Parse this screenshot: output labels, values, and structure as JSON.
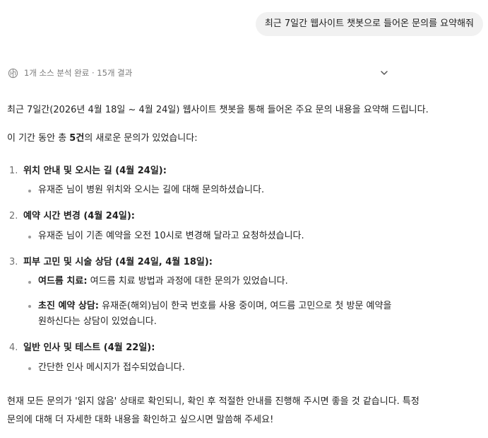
{
  "user_message": "최근 7일간 웹사이트 챗봇으로 들어온 문의를 요약해줘",
  "source_summary": "1개 소스 분석 완료 · 15개 결과",
  "icons": {
    "source": "brain-icon",
    "expand": "chevron-down-icon"
  },
  "answer": {
    "intro": "최근 7일간(2026년 4월 18일 ~ 4월 24일) 웹사이트 챗봇을 통해 들어온 주요 문의 내용을 요약해 드립니다.",
    "count_prefix": "이 기간 동안 총 ",
    "count_bold": "5건",
    "count_suffix": "의 새로운 문의가 있었습니다:",
    "items": [
      {
        "num": "1.",
        "title": "위치 안내 및 오시는 길 (4월 24일):",
        "bullets": [
          {
            "bold": "",
            "text": "유재준 님이 병원 위치와 오시는 길에 대해 문의하셨습니다."
          }
        ]
      },
      {
        "num": "2.",
        "title": "예약 시간 변경 (4월 24일):",
        "bullets": [
          {
            "bold": "",
            "text": "유재준 님이 기존 예약을 오전 10시로 변경해 달라고 요청하셨습니다."
          }
        ]
      },
      {
        "num": "3.",
        "title": "피부 고민 및 시술 상담 (4월 24일, 4월 18일):",
        "bullets": [
          {
            "bold": "여드름 치료:",
            "text": " 여드름 치료 방법과 과정에 대한 문의가 있었습니다."
          },
          {
            "bold": "초진 예약 상담:",
            "text": " 유재준(해외)님이 한국 번호를 사용 중이며, 여드름 고민으로 첫 방문 예약을",
            "text2": "원하신다는 상담이 있었습니다."
          }
        ]
      },
      {
        "num": "4.",
        "title": "일반 인사 및 테스트 (4월 22일):",
        "bullets": [
          {
            "bold": "",
            "text": "간단한 인사 메시지가 접수되었습니다."
          }
        ]
      }
    ],
    "closing_line1": "현재 모든 문의가 '읽지 않음' 상태로 확인되니, 확인 후 적절한 안내를 진행해 주시면 좋을 것 같습니다. 특정",
    "closing_line2": "문의에 대해 더 자세한 대화 내용을 확인하고 싶으시면 말씀해 주세요!"
  }
}
